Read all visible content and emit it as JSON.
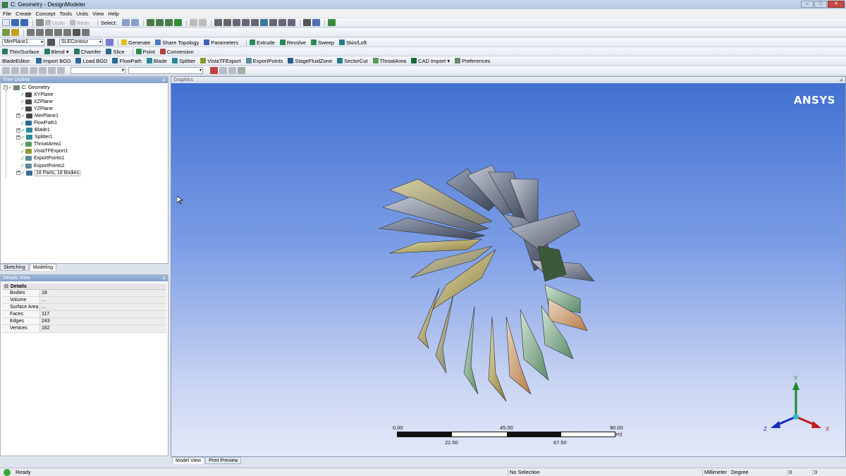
{
  "window": {
    "title": "C: Geometry - DesignModeler"
  },
  "menu": [
    "File",
    "Create",
    "Concept",
    "Tools",
    "Units",
    "View",
    "Help"
  ],
  "toolbar1": {
    "undo": "Undo",
    "redo": "Redo",
    "select_label": "Select:"
  },
  "toolbar2": {
    "plane": "MerPlane1",
    "sketch": "SLEContour",
    "generate": "Generate",
    "share_topology": "Share Topology",
    "parameters": "Parameters",
    "extrude": "Extrude",
    "revolve": "Revolve",
    "sweep": "Sweep",
    "skin_loft": "Skin/Loft"
  },
  "toolbar3": {
    "thin_surface": "Thin/Surface",
    "blend": "Blend",
    "chamfer": "Chamfer",
    "slice": "Slice",
    "point": "Point",
    "conversion": "Conversion"
  },
  "toolbar4": {
    "blade_editor": "BladeEditor:",
    "import_bgd": "Import BGD",
    "load_bgd": "Load BGD",
    "flowpath": "FlowPath",
    "blade": "Blade",
    "splitter": "Splitter",
    "vista_tf_export": "VistaTFExport",
    "export_points": "ExportPoints",
    "stage_fluid_zone": "StageFluidZone",
    "sector_cut": "SectorCut",
    "throat_area": "ThroatArea",
    "cad_import": "CAD Import",
    "preferences": "Preferences"
  },
  "tree": {
    "title": "Tree Outline",
    "root": "C: Geometry",
    "items": [
      "XYPlane",
      "XZPlane",
      "YZPlane",
      "MerPlane1",
      "FlowPath1",
      "Blade1",
      "Splitter1",
      "ThroatArea1",
      "VistaTFExport1",
      "ExportPoints1",
      "ExportPoints2",
      "18 Parts, 18 Bodies"
    ]
  },
  "left_tabs": [
    "Sketching",
    "Modeling"
  ],
  "details": {
    "title": "Details View",
    "group": "Details",
    "rows": [
      {
        "key": "Bodies",
        "value": "18"
      },
      {
        "key": "Volume",
        "value": "..."
      },
      {
        "key": "Surface Area",
        "value": "..."
      },
      {
        "key": "Faces",
        "value": "117"
      },
      {
        "key": "Edges",
        "value": "243"
      },
      {
        "key": "Vertices",
        "value": "162"
      }
    ]
  },
  "graphics": {
    "title": "Graphics",
    "logo": "ANSYS",
    "scale": {
      "t0": "0.00",
      "t1": "45.00",
      "t2": "90.00 (mm)",
      "b1": "22.50",
      "b2": "67.50"
    },
    "triad": {
      "x": "X",
      "y": "Y",
      "z": "Z"
    }
  },
  "bottom_tabs": [
    "Model View",
    "Print Preview"
  ],
  "status": {
    "ready": "Ready",
    "selection": "No Selection",
    "units_length": "Millimeter",
    "units_angle": "Degree",
    "v1": "0",
    "v2": "0"
  },
  "colors": {
    "accent": "#3f6fd0",
    "titlebar": "#b5c9e3"
  }
}
